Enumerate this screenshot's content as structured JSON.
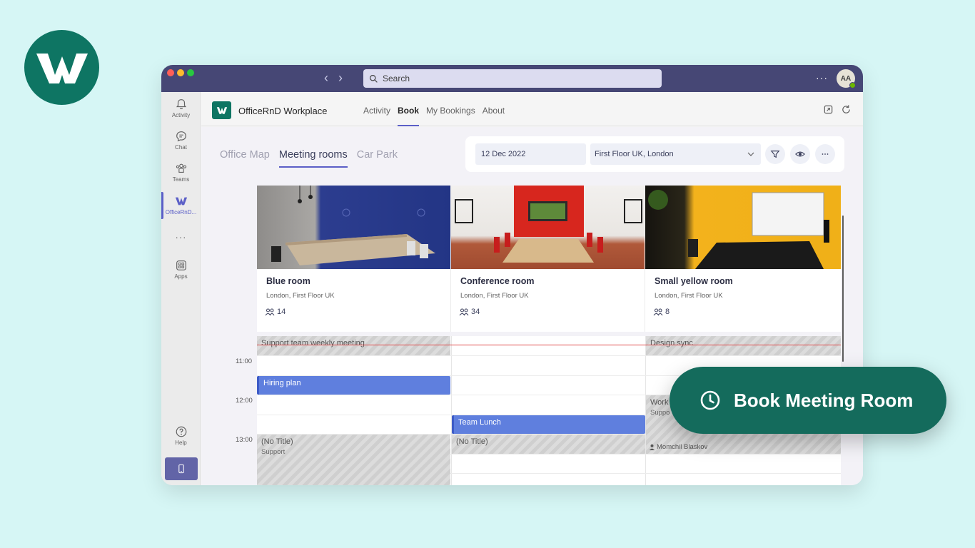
{
  "window": {
    "search_placeholder": "Search",
    "more_label": "···",
    "avatar_initials": "AA"
  },
  "rail": {
    "items": [
      {
        "label": "Activity",
        "icon": "bell-icon"
      },
      {
        "label": "Chat",
        "icon": "chat-icon"
      },
      {
        "label": "Teams",
        "icon": "teams-icon"
      },
      {
        "label": "OfficeRnD...",
        "icon": "officernd-icon"
      },
      {
        "label": "···",
        "icon": "more-icon"
      },
      {
        "label": "Apps",
        "icon": "apps-icon"
      },
      {
        "label": "Help",
        "icon": "help-icon"
      }
    ]
  },
  "app": {
    "name": "OfficeRnD Workplace",
    "tabs": [
      "Activity",
      "Book",
      "My Bookings",
      "About"
    ],
    "active_tab": "Book"
  },
  "view_tabs": {
    "items": [
      "Office Map",
      "Meeting rooms",
      "Car Park"
    ],
    "active": "Meeting rooms"
  },
  "filters": {
    "date": "12 Dec 2022",
    "location": "First Floor UK, London"
  },
  "rooms": [
    {
      "name": "Blue room",
      "location": "London, First Floor UK",
      "capacity": "14"
    },
    {
      "name": "Conference room",
      "location": "London, First Floor UK",
      "capacity": "34"
    },
    {
      "name": "Small yellow room",
      "location": "London, First Floor UK",
      "capacity": "8"
    }
  ],
  "times": [
    "11:00",
    "12:00",
    "13:00"
  ],
  "events": {
    "support_weekly": "Support team weekly meeting",
    "design_sync": "Design sync",
    "hiring_plan": "Hiring plan",
    "work_partial": "Work",
    "support_partial": "Suppo",
    "team_lunch": "Team Lunch",
    "no_title_1": "(No Title)",
    "no_title_1_sub": "Support",
    "no_title_2": "(No Title)",
    "host": "Momchil Blaskov"
  },
  "cta": {
    "label": "Book Meeting Room"
  },
  "colors": {
    "brand_green": "#0e7563",
    "teams_purple": "#464775",
    "accent": "#5b5fc7",
    "event_blue": "#5f7fde",
    "cta_bg": "#146b5c",
    "background": "#d6f6f5"
  }
}
